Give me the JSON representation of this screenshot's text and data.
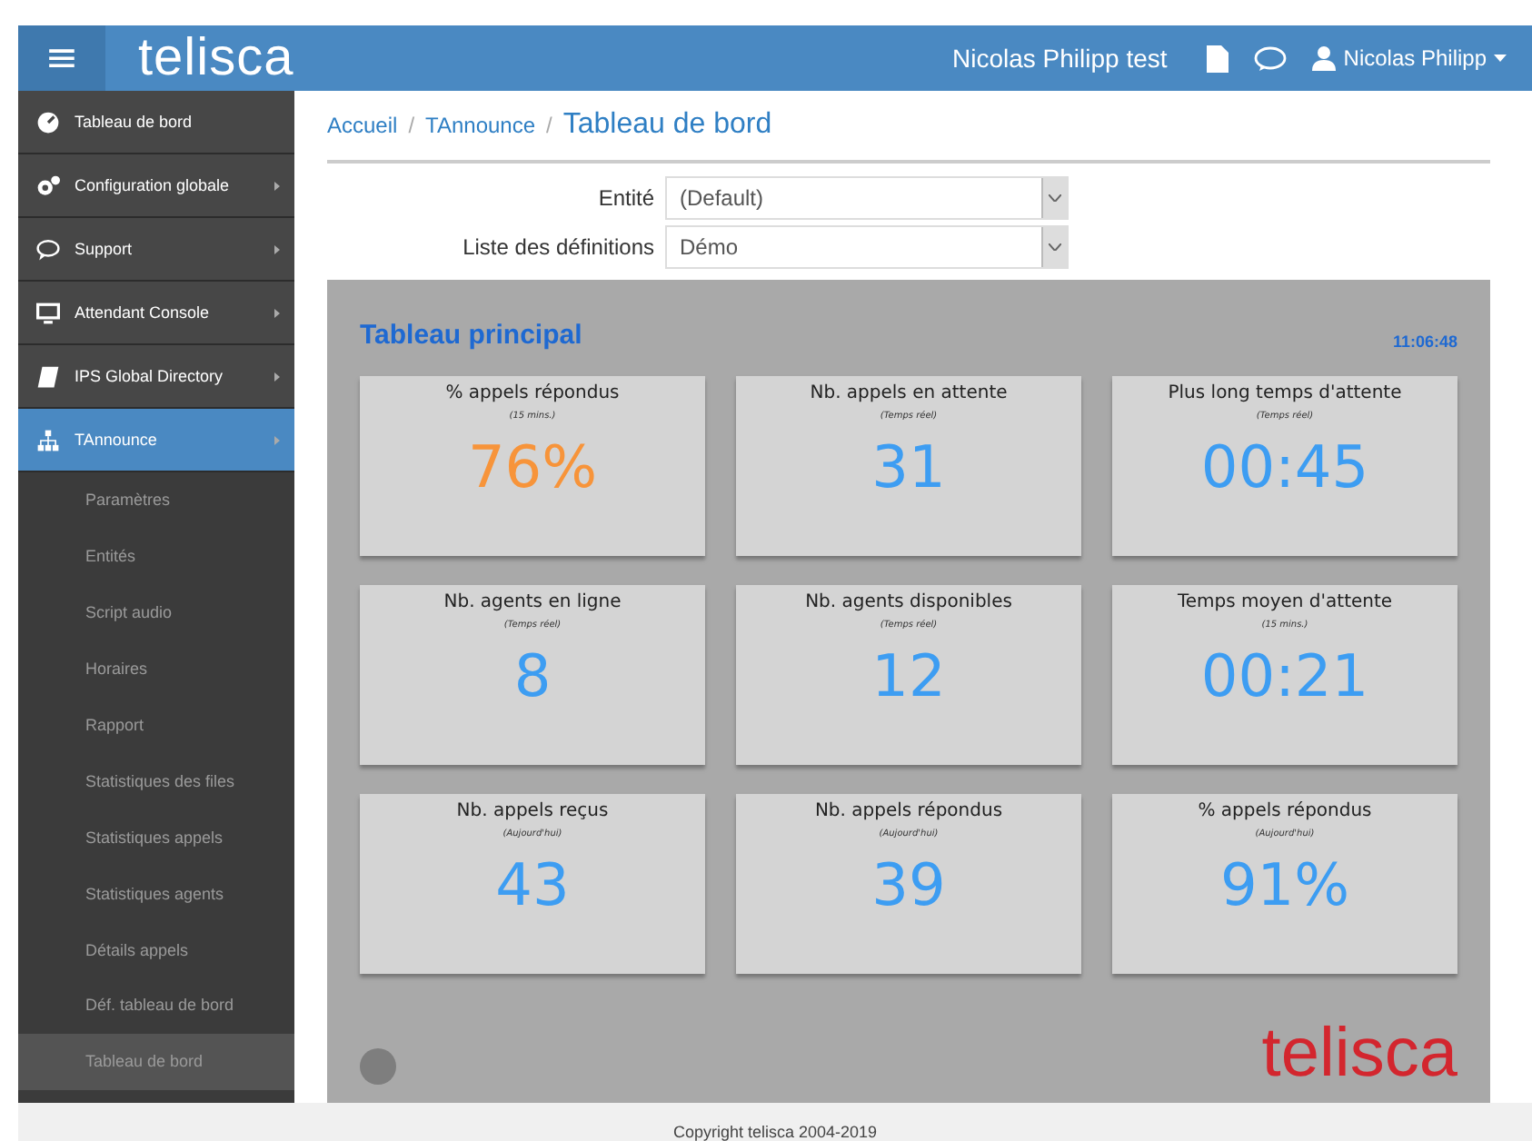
{
  "header": {
    "logo": "telisca",
    "menu_icon": "≡",
    "instance": "Nicolas Philipp test",
    "user": "Nicolas Philipp"
  },
  "sidebar": {
    "items": [
      {
        "label": "Tableau de bord",
        "has_arrow": false,
        "selected": false
      },
      {
        "label": "Configuration globale",
        "has_arrow": true,
        "selected": false
      },
      {
        "label": "Support",
        "has_arrow": true,
        "selected": false
      },
      {
        "label": "Attendant Console",
        "has_arrow": true,
        "selected": false
      },
      {
        "label": "IPS Global Directory",
        "has_arrow": true,
        "selected": false
      },
      {
        "label": "TAnnounce",
        "has_arrow": true,
        "selected": true,
        "children": [
          {
            "label": "Paramètres",
            "selected": false
          },
          {
            "label": "Entités",
            "selected": false
          },
          {
            "label": "Script audio",
            "selected": false
          },
          {
            "label": "Horaires",
            "selected": false
          },
          {
            "label": "Rapport",
            "selected": false
          },
          {
            "label": "Statistiques des files",
            "selected": false
          },
          {
            "label": "Statistiques appels",
            "selected": false
          },
          {
            "label": "Statistiques agents",
            "selected": false
          },
          {
            "label": "Détails appels",
            "selected": false
          },
          {
            "label": "Déf. tableau de bord",
            "selected": false
          },
          {
            "label": "Tableau de bord",
            "selected": true
          }
        ]
      }
    ]
  },
  "breadcrumb": [
    "Accueil",
    "TAnnounce",
    "Tableau de bord"
  ],
  "breadcrumb_separator": "/",
  "form": [
    {
      "label": "Entité",
      "value": "(Default)"
    },
    {
      "label": "Liste des définitions",
      "value": "Démo"
    }
  ],
  "dashboard": {
    "title": "Tableau principal",
    "time": "11:06:48",
    "brand": "telisca",
    "tiles": [
      {
        "title": "% appels répondus",
        "period": "(15 mins.)",
        "value": "76%",
        "color": "#f7943a"
      },
      {
        "title": "Nb. appels en attente",
        "period": "(Temps réel)",
        "value": "31",
        "color": "#3d9df2"
      },
      {
        "title": "Plus long temps d'attente",
        "period": "(Temps réel)",
        "value": "00:45",
        "color": "#3d9df2"
      },
      {
        "title": "Nb. agents en ligne",
        "period": "(Temps réel)",
        "value": "8",
        "color": "#3d9df2"
      },
      {
        "title": "Nb. agents disponibles",
        "period": "(Temps réel)",
        "value": "12",
        "color": "#3d9df2"
      },
      {
        "title": "Temps moyen d'attente",
        "period": "(15 mins.)",
        "value": "00:21",
        "color": "#3d9df2"
      },
      {
        "title": "Nb. appels reçus",
        "period": "(Aujourd'hui)",
        "value": "43",
        "color": "#3d9df2"
      },
      {
        "title": "Nb. appels répondus",
        "period": "(Aujourd'hui)",
        "value": "39",
        "color": "#3d9df2"
      },
      {
        "title": "% appels répondus",
        "period": "(Aujourd'hui)",
        "value": "91%",
        "color": "#3d9df2"
      }
    ]
  },
  "footer": "Copyright telisca 2004-2019"
}
